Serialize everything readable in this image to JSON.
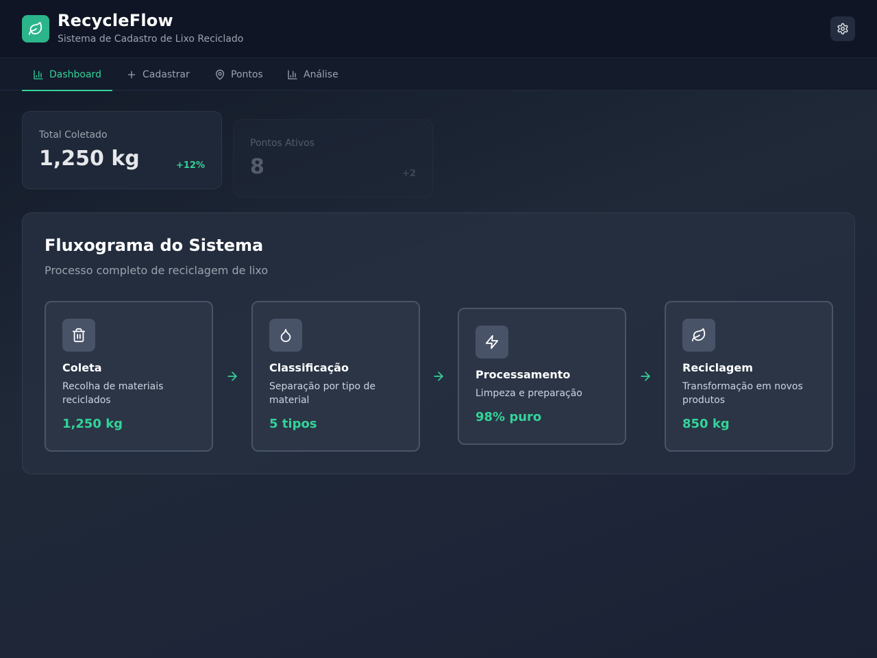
{
  "app": {
    "title": "RecycleFlow",
    "subtitle": "Sistema de Cadastro de Lixo Reciclado",
    "logo_icon": "leaf-icon",
    "accent_color": "#34d399"
  },
  "nav": {
    "tabs": [
      {
        "label": "Dashboard",
        "icon": "bar-chart-icon",
        "active": true
      },
      {
        "label": "Cadastrar",
        "icon": "plus-icon",
        "active": false
      },
      {
        "label": "Pontos",
        "icon": "map-pin-icon",
        "active": false
      },
      {
        "label": "Análise",
        "icon": "bar-chart-icon",
        "active": false
      }
    ]
  },
  "stats": [
    {
      "label": "Total Coletado",
      "value": "1,250 kg",
      "change": "+12%"
    },
    {
      "label": "Pontos Ativos",
      "value": "8",
      "change": "+2"
    }
  ],
  "flow": {
    "title": "Fluxograma do Sistema",
    "subtitle": "Processo completo de reciclagem de lixo",
    "steps": [
      {
        "title": "Coleta",
        "description": "Recolha de materiais reciclados",
        "metric": "1,250 kg",
        "icon": "trash-icon"
      },
      {
        "title": "Classificação",
        "description": "Separação por tipo de material",
        "metric": "5 tipos",
        "icon": "droplet-icon"
      },
      {
        "title": "Processamento",
        "description": "Limpeza e preparação",
        "metric": "98% puro",
        "icon": "zap-icon"
      },
      {
        "title": "Reciclagem",
        "description": "Transformação em novos produtos",
        "metric": "850 kg",
        "icon": "leaf-icon"
      }
    ]
  }
}
